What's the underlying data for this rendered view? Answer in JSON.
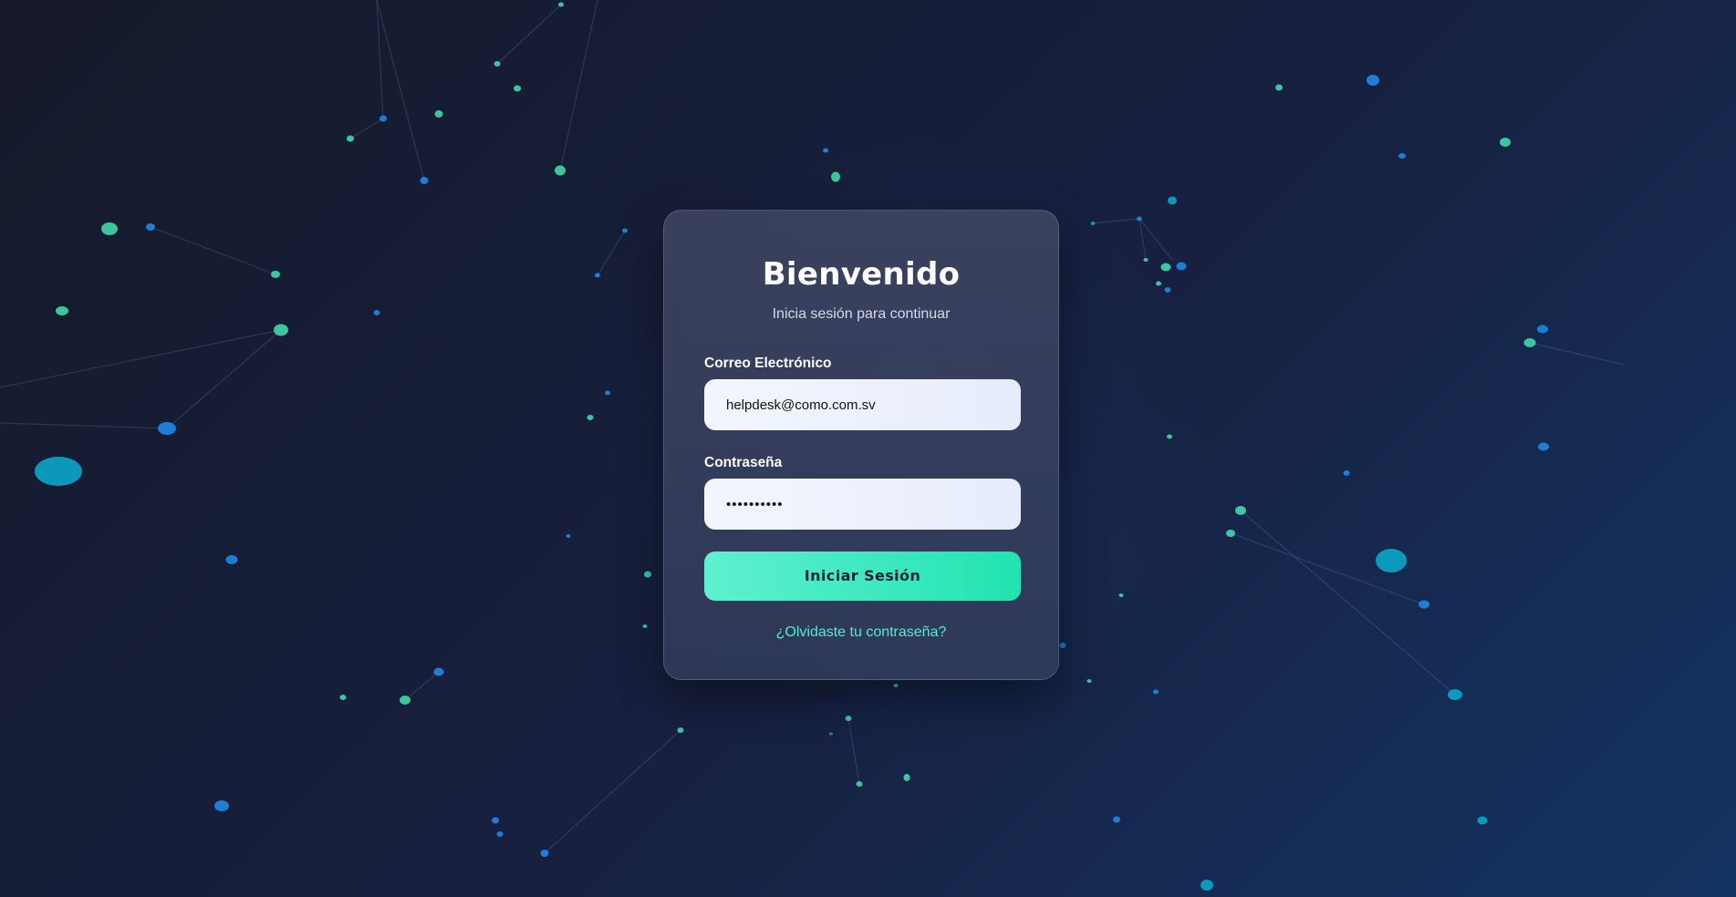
{
  "login": {
    "title": "Bienvenido",
    "subtitle": "Inicia sesión para continuar",
    "email_label": "Correo Electrónico",
    "email_value": "helpdesk@como.com.sv",
    "password_label": "Contraseña",
    "password_value": "••••••••••",
    "submit_label": "Iniciar Sesión",
    "forgot_link": "¿Olvidaste tu contraseña?"
  },
  "colors": {
    "background_dark": "#161a2b",
    "background_light": "#143463",
    "accent": "#22e3b0",
    "link": "#4ef0cc",
    "particle_green": "#3fd9a8",
    "particle_blue": "#1e88e5",
    "particle_cyan": "#0aa6c9"
  }
}
